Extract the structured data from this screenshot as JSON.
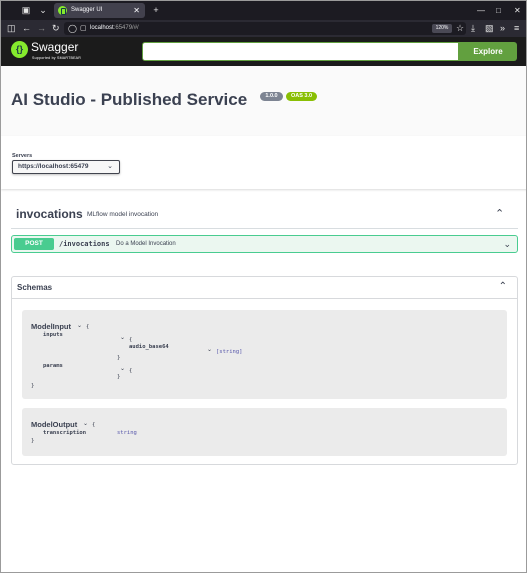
{
  "browser": {
    "tab_title": "Swagger UI",
    "url_host": "localhost",
    "url_rest": ":65479/#/",
    "zoom": "120%"
  },
  "topbar": {
    "logo_text": "Swagger",
    "logo_sub": "Supported by SMARTBEAR",
    "search_value": "",
    "explore_label": "Explore"
  },
  "info": {
    "title": "AI Studio - Published Service",
    "version": "1.0.0",
    "oas": "OAS 3.0"
  },
  "servers": {
    "label": "Servers",
    "selected": "https://localhost:65479"
  },
  "tag": {
    "name": "invocations",
    "description": "MLflow model invocation"
  },
  "operation": {
    "method": "POST",
    "path": "/invocations",
    "summary": "Do a Model Invocation"
  },
  "schemas": {
    "title": "Schemas",
    "model_input": {
      "name": "ModelInput",
      "brace_open": "{",
      "brace_close": "}",
      "inputs_label": "inputs",
      "inputs_brace_open": "{",
      "inputs_brace_close": "}",
      "audio_label": "audio_base64",
      "audio_type": "[string]",
      "params_label": "params",
      "params_brace_open": "{",
      "params_brace_close": "}"
    },
    "model_output": {
      "name": "ModelOutput",
      "brace_open": "{",
      "brace_close": "}",
      "transcription_label": "transcription",
      "transcription_type": "string"
    }
  },
  "colors": {
    "post": "#49cc90",
    "swagger_green": "#85ea2d",
    "explore": "#62a03f"
  }
}
